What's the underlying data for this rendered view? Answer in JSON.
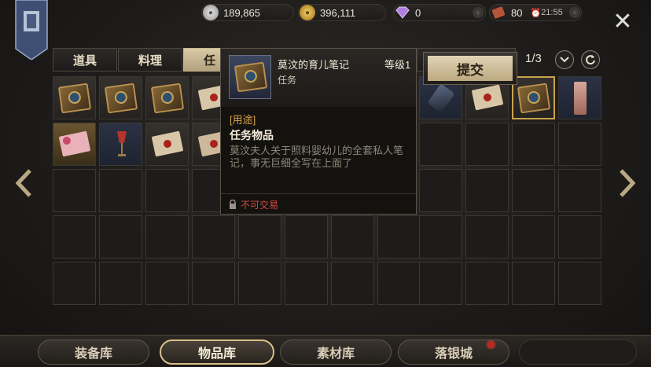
{
  "currencies": {
    "silver": {
      "value": "189,865",
      "icon": "silver-coin-icon"
    },
    "gold": {
      "value": "396,111",
      "icon": "gold-coin-icon"
    },
    "diamond": {
      "value": "0",
      "icon": "diamond-icon"
    },
    "ticket": {
      "value": "80",
      "icon": "ticket-icon"
    },
    "timer": {
      "value": "21:55",
      "icon": "clock-icon"
    }
  },
  "tabs": [
    {
      "label": "道具"
    },
    {
      "label": "料理"
    },
    {
      "label": "任务",
      "visible": "任"
    }
  ],
  "active_tab": 2,
  "pagination": {
    "text": "1/3"
  },
  "submit_label": "提交",
  "tooltip": {
    "name": "莫汶的育儿笔记",
    "level": "等级1",
    "type": "任务",
    "usage_label": "[用途]",
    "category": "任务物品",
    "description": "莫汶夫人关于照料婴幼儿的全套私人笔记，事无巨细全写在上面了",
    "restriction": "不可交易"
  },
  "bottom_tabs": [
    {
      "label": "装备库"
    },
    {
      "label": "物品库"
    },
    {
      "label": "素材库"
    },
    {
      "label": "落银城"
    }
  ],
  "active_bottom_tab": 1,
  "colors": {
    "accent_gold": "#d9c08a",
    "tab_active": "#d8c9a7",
    "restricted_red": "#d24a3c",
    "usage_orange": "#d9a44a"
  }
}
